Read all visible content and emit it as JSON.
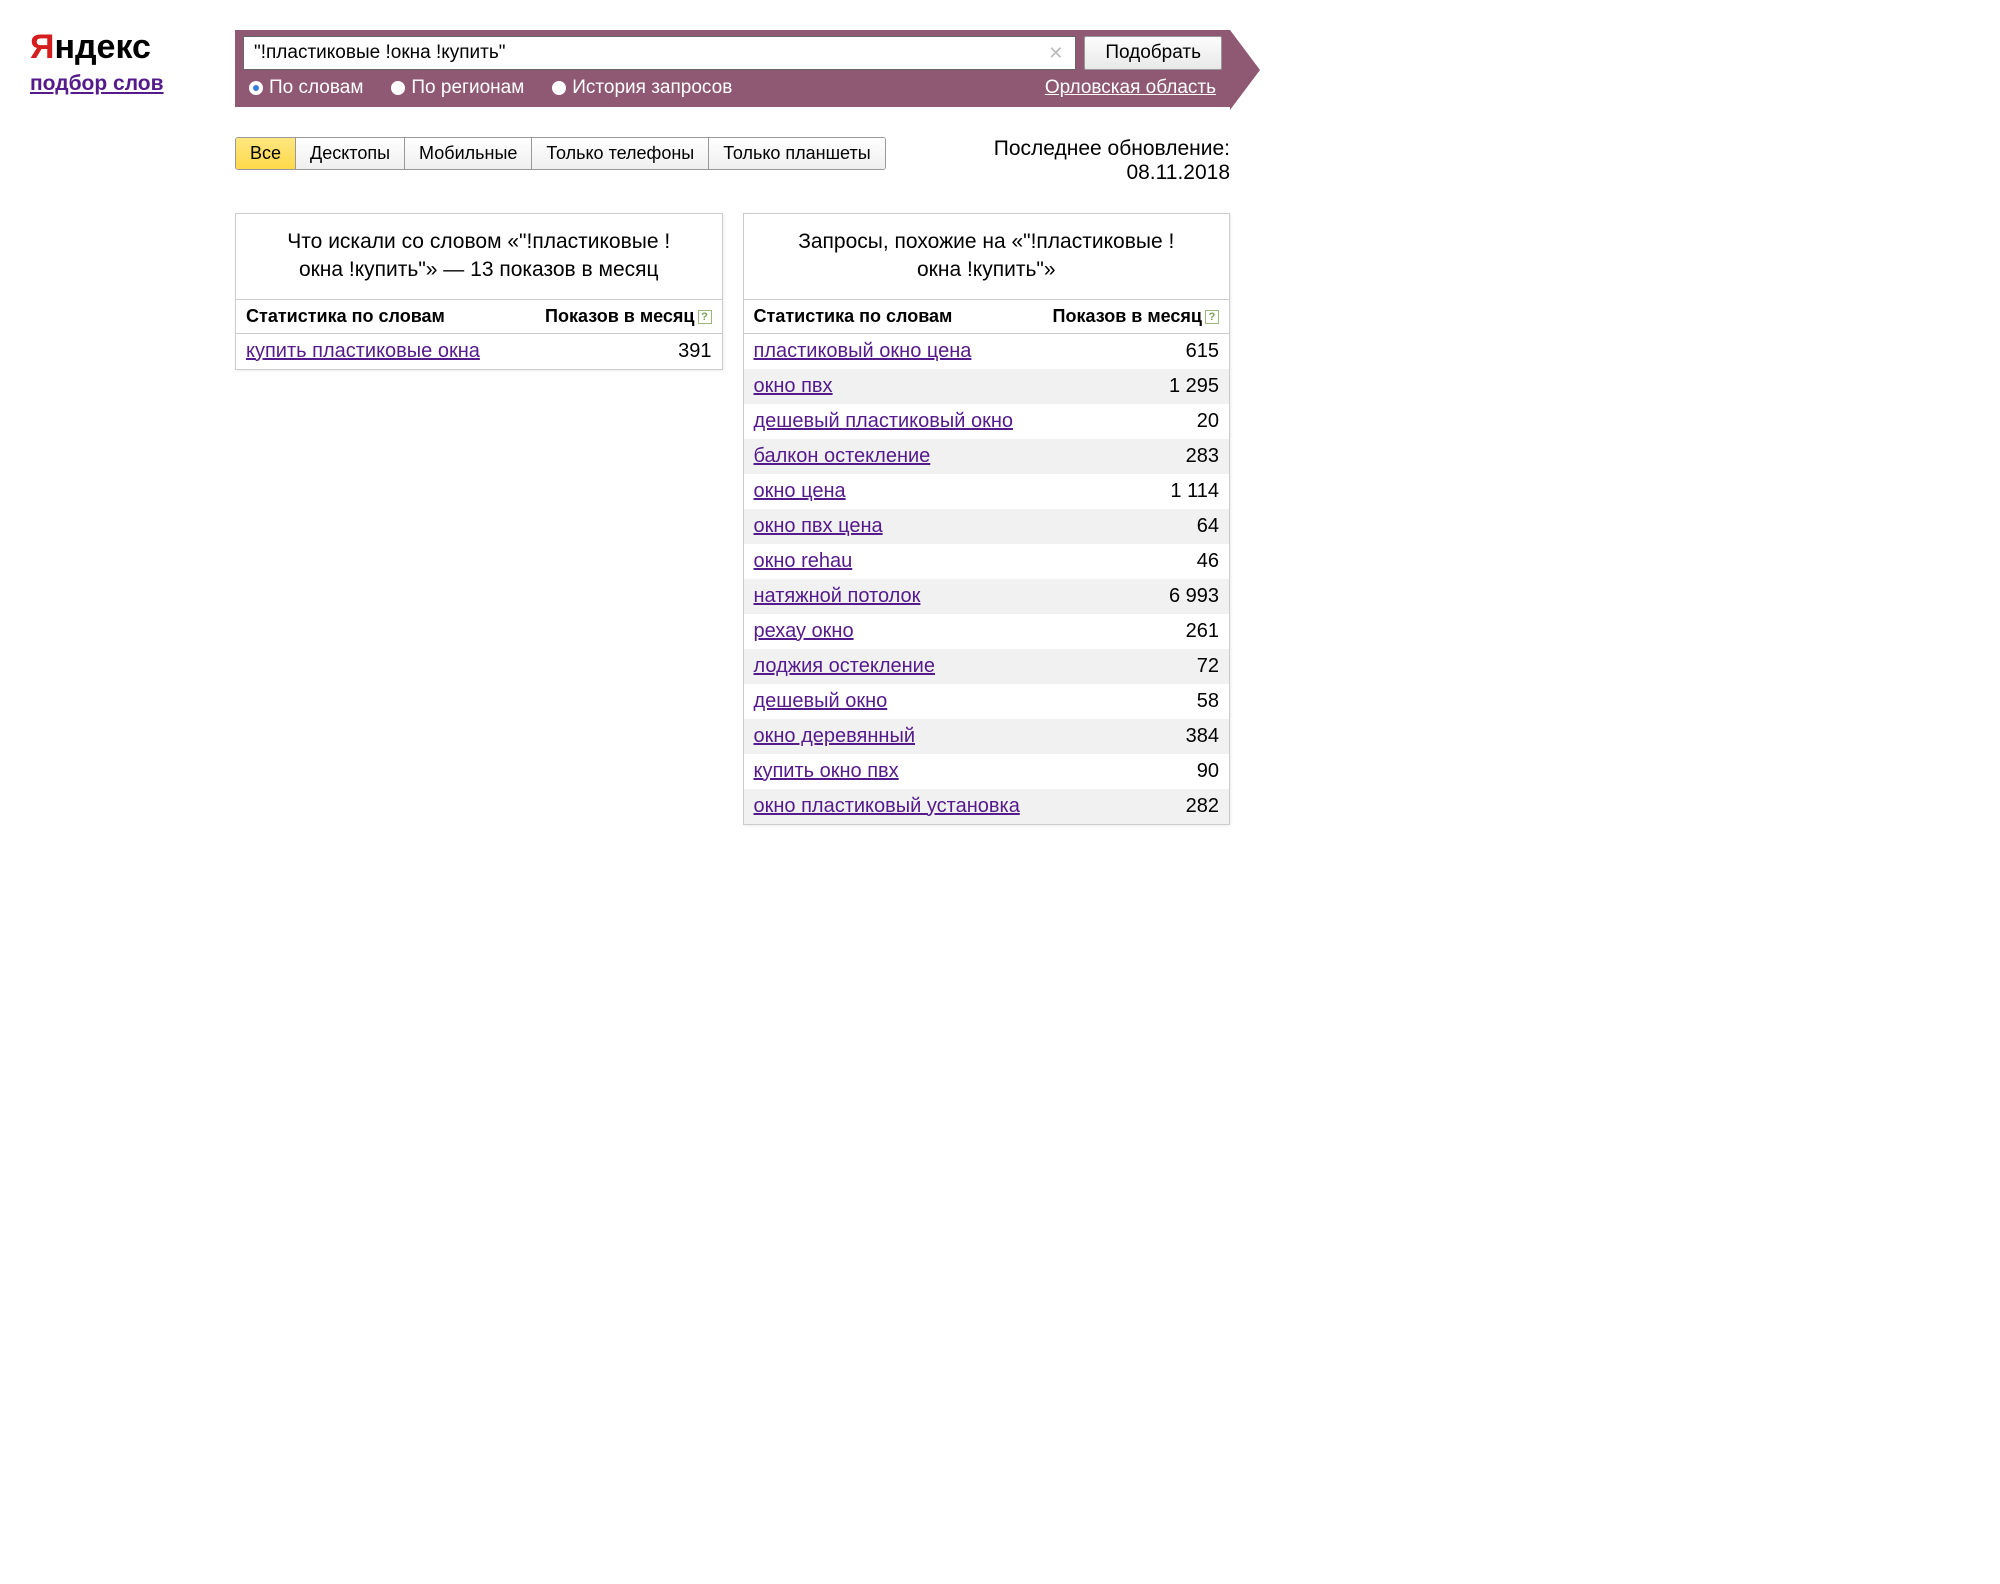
{
  "logo": {
    "y": "Я",
    "rest": "ндекс"
  },
  "subtitle": "подбор слов",
  "search": {
    "value": "\"!пластиковые !окна !купить\"",
    "button": "Подобрать",
    "radios": [
      {
        "label": "По словам",
        "selected": true
      },
      {
        "label": "По регионам",
        "selected": false
      },
      {
        "label": "История запросов",
        "selected": false
      }
    ],
    "region": "Орловская область"
  },
  "segments": [
    {
      "label": "Все",
      "active": true
    },
    {
      "label": "Десктопы",
      "active": false
    },
    {
      "label": "Мобильные",
      "active": false
    },
    {
      "label": "Только телефоны",
      "active": false
    },
    {
      "label": "Только планшеты",
      "active": false
    }
  ],
  "update": {
    "label": "Последнее обновление:",
    "date": "08.11.2018"
  },
  "columns": {
    "stat": "Статистика по словам",
    "impressions": "Показов в месяц",
    "help": "?"
  },
  "left_panel": {
    "title": "Что искали со словом «\"!пластиковые !окна !купить\"» — 13 показов в месяц",
    "rows": [
      {
        "kw": "купить пластиковые окна",
        "count": "391"
      }
    ]
  },
  "right_panel": {
    "title": "Запросы, похожие на «\"!пластиковые !окна !купить\"»",
    "rows": [
      {
        "kw": "пластиковый окно цена",
        "count": "615"
      },
      {
        "kw": "окно пвх",
        "count": "1 295"
      },
      {
        "kw": "дешевый пластиковый окно",
        "count": "20"
      },
      {
        "kw": "балкон остекление",
        "count": "283"
      },
      {
        "kw": "окно цена",
        "count": "1 114"
      },
      {
        "kw": "окно пвх цена",
        "count": "64"
      },
      {
        "kw": "окно rehau",
        "count": "46"
      },
      {
        "kw": "натяжной потолок",
        "count": "6 993"
      },
      {
        "kw": "рехау окно",
        "count": "261"
      },
      {
        "kw": "лоджия остекление",
        "count": "72"
      },
      {
        "kw": "дешевый окно",
        "count": "58"
      },
      {
        "kw": "окно деревянный",
        "count": "384"
      },
      {
        "kw": "купить окно пвх",
        "count": "90"
      },
      {
        "kw": "окно пластиковый установка",
        "count": "282"
      }
    ]
  }
}
